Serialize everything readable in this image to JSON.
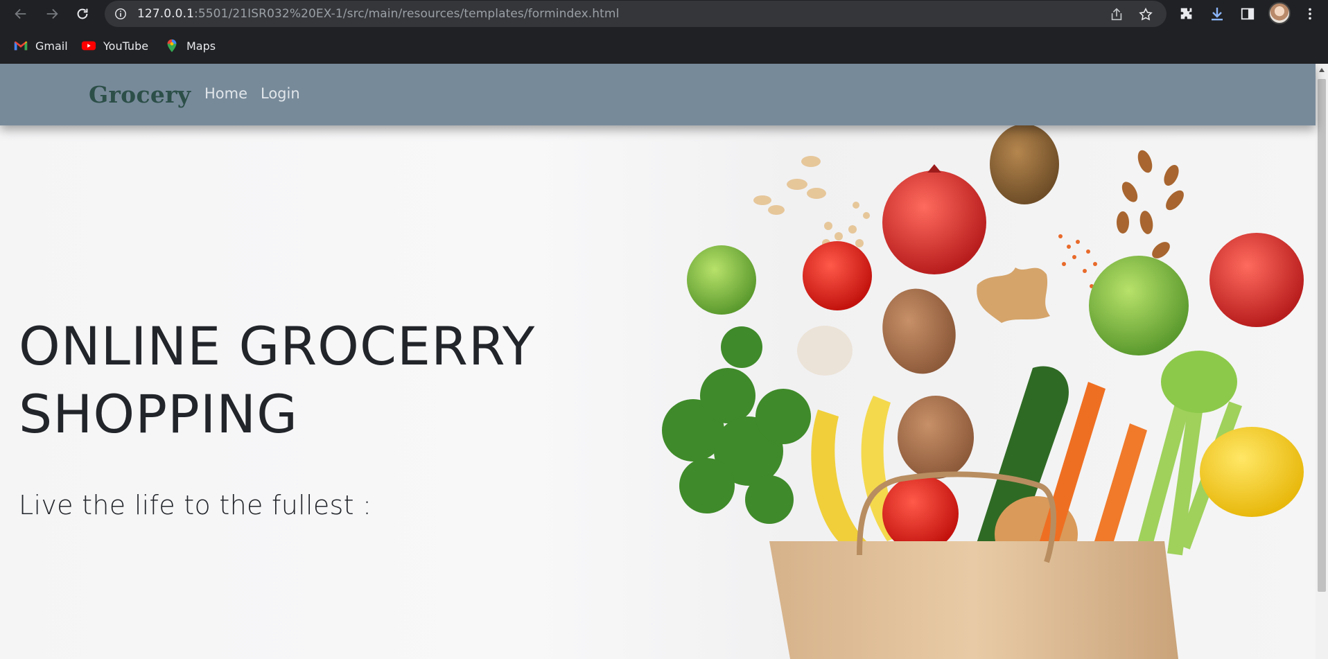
{
  "browser": {
    "url_host": "127.0.0.1",
    "url_rest": ":5501/21ISR032%20EX-1/src/main/resources/templates/formindex.html",
    "bookmarks": [
      {
        "label": "Gmail",
        "icon": "gmail-icon"
      },
      {
        "label": "YouTube",
        "icon": "youtube-icon"
      },
      {
        "label": "Maps",
        "icon": "maps-icon"
      }
    ]
  },
  "navbar": {
    "brand": "Grocery",
    "links": [
      "Home",
      "Login"
    ]
  },
  "hero": {
    "title_line1": "ONLINE GROCERRY",
    "title_line2": "SHOPPING",
    "subtitle": "Live the life to the fullest :"
  },
  "colors": {
    "chrome_bg": "#202124",
    "navbar_bg": "#778a9a",
    "brand": "#2c4f48",
    "hero_text": "#22252a"
  }
}
